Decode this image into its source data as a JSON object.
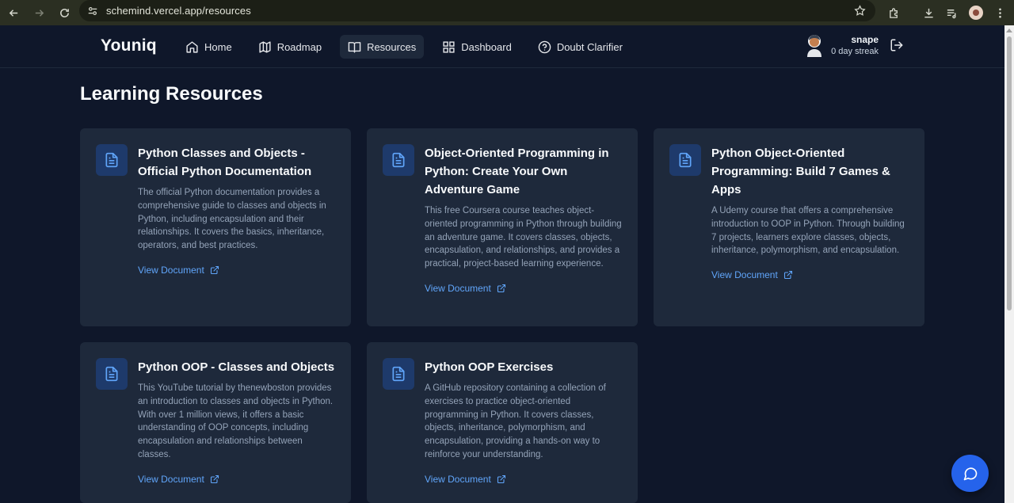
{
  "browser": {
    "url": "schemind.vercel.app/resources"
  },
  "app": {
    "brand": "Youniq",
    "nav": [
      {
        "label": "Home",
        "icon": "home-icon"
      },
      {
        "label": "Roadmap",
        "icon": "map-icon"
      },
      {
        "label": "Resources",
        "icon": "book-open-icon",
        "active": true
      },
      {
        "label": "Dashboard",
        "icon": "dashboard-icon"
      },
      {
        "label": "Doubt Clarifier",
        "icon": "help-circle-icon"
      }
    ],
    "user": {
      "name": "snape",
      "streak": "0 day streak"
    },
    "page_title": "Learning Resources",
    "cards": [
      {
        "title": "Python Classes and Objects - Official Python Documentation",
        "description": "The official Python documentation provides a comprehensive guide to classes and objects in Python, including encapsulation and their relationships. It covers the basics, inheritance, operators, and best practices.",
        "link": "View Document"
      },
      {
        "title": "Object-Oriented Programming in Python: Create Your Own Adventure Game",
        "description": "This free Coursera course teaches object-oriented programming in Python through building an adventure game. It covers classes, objects, encapsulation, and relationships, and provides a practical, project-based learning experience.",
        "link": "View Document"
      },
      {
        "title": "Python Object-Oriented Programming: Build 7 Games & Apps",
        "description": "A Udemy course that offers a comprehensive introduction to OOP in Python. Through building 7 projects, learners explore classes, objects, inheritance, polymorphism, and encapsulation.",
        "link": "View Document"
      },
      {
        "title": "Python OOP - Classes and Objects",
        "description": "This YouTube tutorial by thenewboston provides an introduction to classes and objects in Python. With over 1 million views, it offers a basic understanding of OOP concepts, including encapsulation and relationships between classes.",
        "link": "View Document"
      },
      {
        "title": "Python OOP Exercises",
        "description": "A GitHub repository containing a collection of exercises to practice object-oriented programming in Python. It covers classes, objects, inheritance, polymorphism, and encapsulation, providing a hands-on way to reinforce your understanding.",
        "link": "View Document"
      }
    ],
    "colors": {
      "background": "#0f172a",
      "card": "#1e293b",
      "accent": "#60a5fa",
      "chat_button": "#2563eb"
    }
  }
}
